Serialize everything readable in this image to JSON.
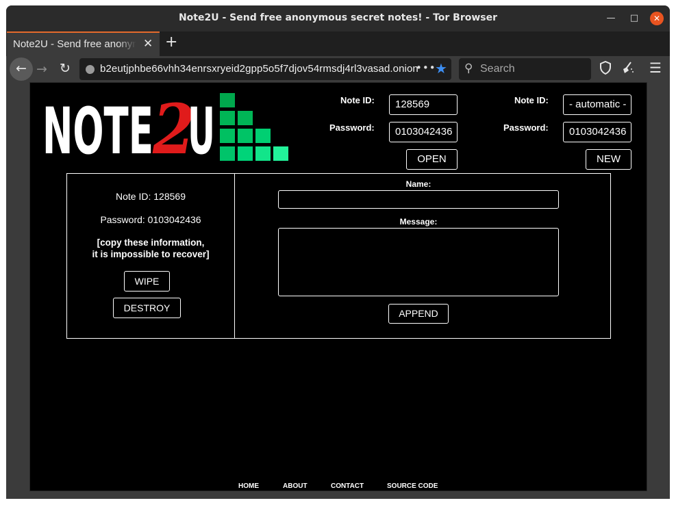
{
  "window": {
    "title": "Note2U - Send free anonymous secret notes! - Tor Browser"
  },
  "tabs": [
    {
      "label": "Note2U - Send free anonymous secret notes!"
    }
  ],
  "toolbar": {
    "url": "b2eutjphbe66vhh34enrsxryeid2gpp5o5f7djov54rmsdj4rl3vasad.onion",
    "search_placeholder": "Search"
  },
  "icons": {
    "back": "back-arrow-icon",
    "forward": "forward-arrow-icon",
    "reload": "reload-icon",
    "bookmark": "star-icon",
    "search": "search-icon",
    "shield": "shield-icon",
    "new_identity": "broom-icon",
    "menu": "hamburger-menu-icon"
  },
  "logo": {
    "text_part1": "NOTE",
    "text_part2": "2",
    "text_part3": "U",
    "accent_color": "#e01b1b",
    "bar_colors": [
      "#00b050",
      "#00d07a",
      "#22f29a"
    ]
  },
  "open_form": {
    "note_id_label": "Note ID:",
    "note_id_value": "128569",
    "password_label": "Password:",
    "password_value": "0103042436",
    "button_label": "OPEN"
  },
  "new_form": {
    "note_id_label": "Note ID:",
    "note_id_value": "- automatic -",
    "password_label": "Password:",
    "password_value": "0103042436",
    "button_label": "NEW"
  },
  "note_info": {
    "note_id_text": "Note ID: 128569",
    "password_text": "Password: 0103042436",
    "warning_line1": "[copy these information,",
    "warning_line2": "it is impossible to recover]",
    "wipe_label": "WIPE",
    "destroy_label": "DESTROY"
  },
  "compose": {
    "name_label": "Name:",
    "name_value": "",
    "message_label": "Message:",
    "message_value": "",
    "append_label": "APPEND"
  },
  "footer": {
    "links": [
      "HOME",
      "ABOUT",
      "CONTACT",
      "SOURCE CODE"
    ]
  }
}
